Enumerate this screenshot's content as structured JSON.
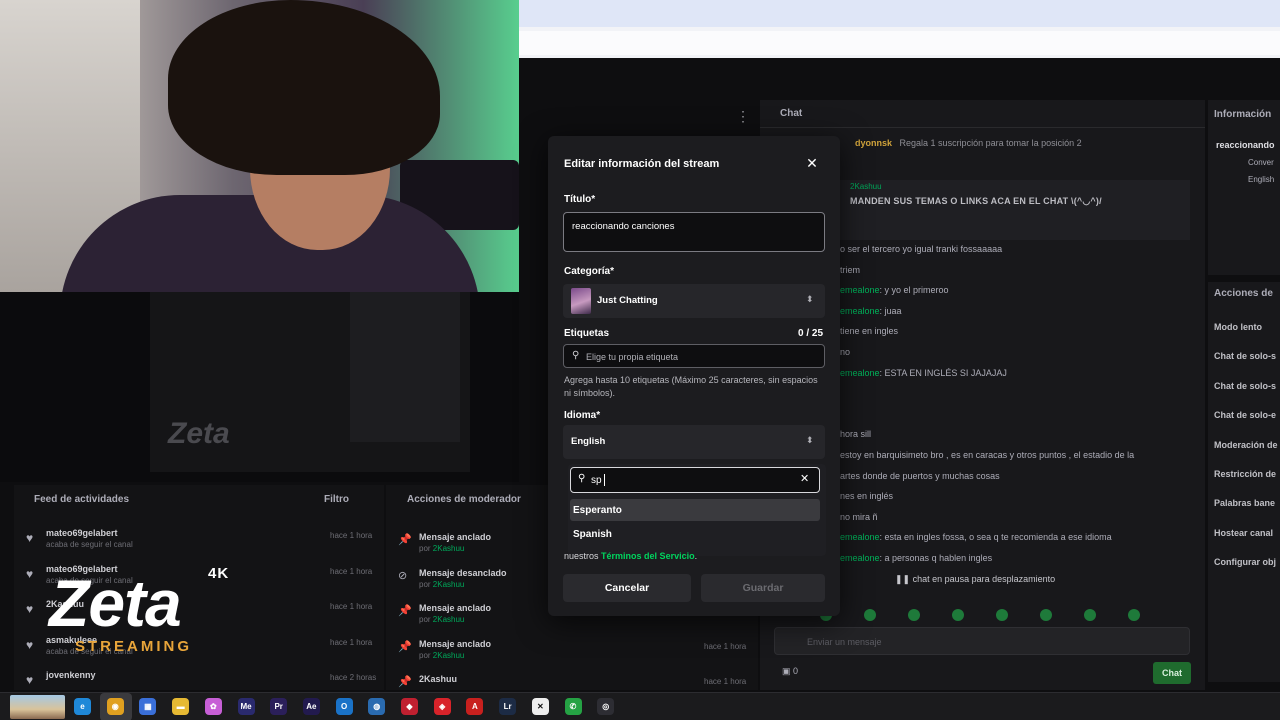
{
  "background": {
    "chat_header": "Chat",
    "pinned_user": "dyonnsk",
    "gift_text": "Regala 1 suscripción para tomar la posición 2",
    "pinned_author": "2Kashuu",
    "pinned_message": "MANDEN SUS TEMAS O LINKS ACA EN EL CHAT \\(^◡^)/",
    "chat_lines": [
      {
        "user": "",
        "text": "o ser el tercero yo igual tranki fossaaaaa"
      },
      {
        "user": "",
        "text": "triem"
      },
      {
        "user": "emealone",
        "text": ": y yo el primeroo"
      },
      {
        "user": "emealone",
        "text": ": juaa"
      },
      {
        "user": "",
        "text": "tiene en ingles"
      },
      {
        "user": "",
        "text": "no"
      },
      {
        "user": "emealone",
        "text": ": ESTA EN INGLÉS SI JAJAJAJ"
      },
      {
        "user": "",
        "text": ""
      },
      {
        "user": "",
        "text": ""
      },
      {
        "user": "",
        "text": "hora sill"
      },
      {
        "user": "",
        "text": "estoy en barquisimeto bro , es en caracas y otros puntos , el estadio de la"
      },
      {
        "user": "",
        "text": "artes donde de puertos y muchas cosas"
      },
      {
        "user": "",
        "text": "nes en inglés"
      },
      {
        "user": "",
        "text": "no mira ñ"
      },
      {
        "user": "emealone",
        "text": ": esta en ingles fossa, o sea q te recomienda a ese idioma"
      },
      {
        "user": "emealone",
        "text": ": a personas q hablen ingles"
      }
    ],
    "chat_paused": "chat en pausa para desplazamiento",
    "chat_input_placeholder": "Enviar un mensaje",
    "chat_points": "0",
    "chat_button": "Chat",
    "info_title": "Información",
    "info_stream": "reaccionando",
    "info_category": "Conver",
    "info_language": "English",
    "mod_title": "Acciones de",
    "mod_items": [
      "Modo lento",
      "Chat de solo-s",
      "Chat de solo-s",
      "Chat de solo-e",
      "Moderación de",
      "Restricción de",
      "Palabras bane",
      "Hostear canal",
      "Configurar obj"
    ],
    "feed_title": "Feed de actividades",
    "feed_filter": "Filtro",
    "feed_items": [
      {
        "name": "mateo69gelabert",
        "desc": "acaba de seguir el canal",
        "time": "hace 1 hora"
      },
      {
        "name": "mateo69gelabert",
        "desc": "acaba de seguir el canal",
        "time": "hace 1 hora"
      },
      {
        "name": "2Kashuu",
        "desc": "",
        "time": "hace 1 hora"
      },
      {
        "name": "asmakuleee",
        "desc": "acaba de seguir el canal",
        "time": "hace 1 hora"
      },
      {
        "name": "jovenkenny",
        "desc": "",
        "time": "hace 2 horas"
      }
    ],
    "modact_title": "Acciones de moderador",
    "modact_items": [
      {
        "name": "Mensaje anclado",
        "by": "por",
        "user": "2Kashuu",
        "time": "hace 1 hora"
      },
      {
        "name": "Mensaje desanclado",
        "by": "por",
        "user": "2Kashuu",
        "time": "hace 1 hora"
      },
      {
        "name": "Mensaje anclado",
        "by": "por",
        "user": "2Kashuu",
        "time": "hace 1 hora"
      },
      {
        "name": "Mensaje anclado",
        "by": "por",
        "user": "2Kashuu",
        "time": "hace 1 hora"
      },
      {
        "name": "2Kashuu",
        "by": "",
        "user": "",
        "time": "hace 1 hora"
      }
    ]
  },
  "overlay": {
    "logo_main": "Zeta",
    "logo_badge": "4K",
    "logo_sub": "STREAMING",
    "preview_logo": "Zeta"
  },
  "modal": {
    "title": "Editar información del stream",
    "close_icon": "close-icon",
    "title_label": "Título*",
    "title_value": "reaccionando canciones",
    "category_label": "Categoría*",
    "category_value": "Just Chatting",
    "tags_label": "Etiquetas",
    "tags_counter": "0 / 25",
    "tags_placeholder": "Elige tu propia etiqueta",
    "tags_help": "Agrega hasta 10 etiquetas (Máximo 25 caracteres, sin espacios ni símbolos).",
    "language_label": "Idioma*",
    "language_value": "English",
    "language_search_value": "sp",
    "language_options": [
      "Esperanto",
      "Spanish"
    ],
    "terms_prefix": "nuestros",
    "terms_link": "Términos del Servicio",
    "terms_suffix": ".",
    "cancel_label": "Cancelar",
    "save_label": "Guardar"
  },
  "taskbar": {
    "icons": [
      {
        "name": "edge-icon",
        "label": "e",
        "color": "#1f88d8"
      },
      {
        "name": "chrome-icon",
        "label": "◉",
        "color": "#e0a020"
      },
      {
        "name": "store-icon",
        "label": "▦",
        "color": "#3a6fd8"
      },
      {
        "name": "folder-icon",
        "label": "▬",
        "color": "#e6b933"
      },
      {
        "name": "photos-icon",
        "label": "✿",
        "color": "#c75fd6"
      },
      {
        "name": "media-encoder-icon",
        "label": "Me",
        "color": "#2a2a6e"
      },
      {
        "name": "premiere-icon",
        "label": "Pr",
        "color": "#2b1f5a"
      },
      {
        "name": "after-effects-icon",
        "label": "Ae",
        "color": "#221a4e"
      },
      {
        "name": "outlook-icon",
        "label": "O",
        "color": "#1a72c7"
      },
      {
        "name": "globe-icon",
        "label": "◍",
        "color": "#2a6bb0"
      },
      {
        "name": "shield-icon",
        "label": "◆",
        "color": "#c02030"
      },
      {
        "name": "anydesk-icon",
        "label": "◈",
        "color": "#d8232a"
      },
      {
        "name": "acrobat-icon",
        "label": "A",
        "color": "#c8201e"
      },
      {
        "name": "lightroom-icon",
        "label": "Lr",
        "color": "#1c2b45"
      },
      {
        "name": "capcut-icon",
        "label": "✕",
        "color": "#eeeeee"
      },
      {
        "name": "whatsapp-icon",
        "label": "✆",
        "color": "#25a244"
      },
      {
        "name": "obs-icon",
        "label": "◎",
        "color": "#2d2d33"
      }
    ]
  }
}
